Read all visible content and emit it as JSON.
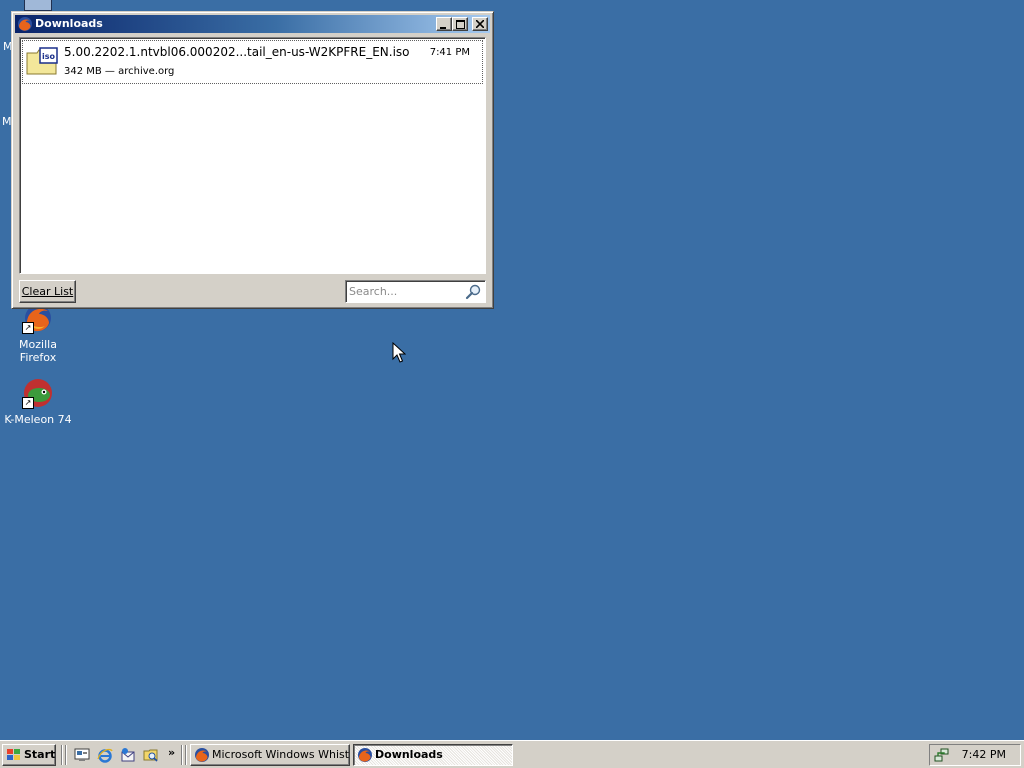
{
  "desktop": {
    "icons": [
      {
        "label": "Mozilla Firefox",
        "icon": "firefox-icon"
      },
      {
        "label": "K-Meleon 74",
        "icon": "kmeleon-icon"
      }
    ],
    "partial_labels": [
      "M",
      "M"
    ]
  },
  "window": {
    "title": "Downloads",
    "controls": {
      "minimize": "minimize-icon",
      "maximize": "maximize-icon",
      "close": "close-icon"
    },
    "downloads": [
      {
        "filename": "5.00.2202.1.ntvbl06.000202...tail_en-us-W2KPFRE_EN.iso",
        "time": "7:41 PM",
        "info": "342 MB — archive.org",
        "icon_text": "iso"
      }
    ],
    "clear_button": "Clear List",
    "search_placeholder": "Search..."
  },
  "taskbar": {
    "start_label": "Start",
    "quick_launch": [
      "show-desktop-icon",
      "internet-explorer-icon",
      "outlook-express-icon",
      "windows-explorer-icon"
    ],
    "more_label": "»",
    "tasks": [
      {
        "label": "Microsoft Windows Whistl...",
        "icon": "firefox-icon",
        "active": false
      },
      {
        "label": "Downloads",
        "icon": "firefox-icon",
        "active": true
      }
    ],
    "clock": "7:42 PM"
  },
  "colors": {
    "desktop": "#3a6ea5",
    "titlebar_start": "#0a246a",
    "face": "#d4d0c8"
  }
}
